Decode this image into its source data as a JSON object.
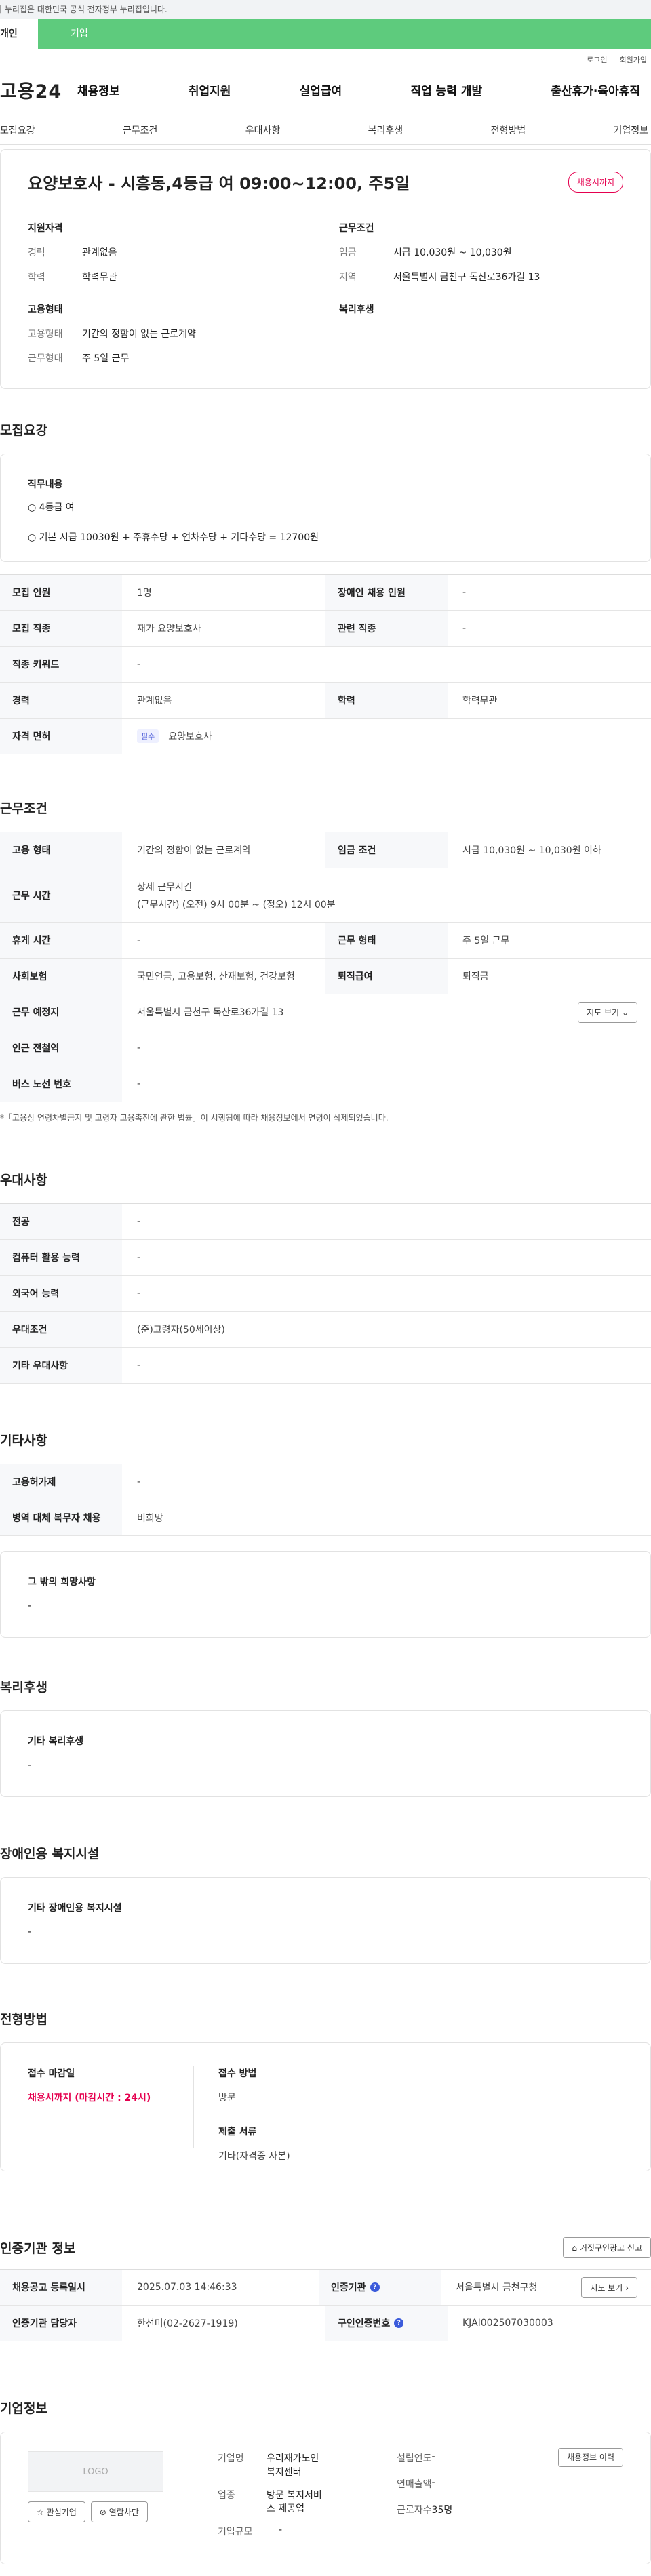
{
  "banner": "이 누리집은 대한민국 공식 전자정부 누리집입니다.",
  "tabs": [
    "개인",
    "기업"
  ],
  "util": [
    "로그인",
    "회원가입"
  ],
  "logo": "고용24",
  "gnb": [
    "채용정보",
    "취업지원",
    "실업급여",
    "직업 능력 개발",
    "출산휴가·육아휴직"
  ],
  "lnb": [
    "모집요강",
    "근무조건",
    "우대사항",
    "복리후생",
    "전형방법",
    "기업정보"
  ],
  "title": "요양보호사 - 시흥동,4등급 여 09:00~12:00, 주5일",
  "badge": "채용시까지",
  "summary": {
    "left_title": "지원자격",
    "left": [
      [
        "경력",
        "관계없음"
      ],
      [
        "학력",
        "학력무관"
      ]
    ],
    "right_title": "근무조건",
    "right": [
      [
        "임금",
        "시급 10,030원 ~ 10,030원"
      ],
      [
        "지역",
        "서울특별시 금천구 독산로36가길 13"
      ]
    ],
    "emp_title": "고용형태",
    "emp": [
      [
        "고용형태",
        "기간의 정함이 없는 근로계약"
      ],
      [
        "근무형태",
        "주 5일 근무"
      ]
    ],
    "welfare_title": "복리후생"
  },
  "recruit": {
    "title": "모집요강",
    "job_label": "직무내용",
    "job_lines": [
      "○ 4등급 여",
      "○ 기본 시급 10030원 + 주휴수당 + 연차수당 + 기타수당 = 12700원"
    ],
    "rows": [
      [
        "모집 인원",
        "1명",
        "장애인 채용 인원",
        "-"
      ],
      [
        "모집 직종",
        "재가 요양보호사",
        "관련 직종",
        "-"
      ],
      [
        "직종 키워드",
        "-"
      ],
      [
        "경력",
        "관계없음",
        "학력",
        "학력무관"
      ],
      [
        "자격 면허",
        "필수",
        "요양보호사"
      ]
    ]
  },
  "work": {
    "title": "근무조건",
    "rows": [
      [
        "고용 형태",
        "기간의 정함이 없는 근로계약",
        "임금 조건",
        "시급 10,030원 ~ 10,030원 이하"
      ],
      [
        "근무 시간",
        "상세 근무시간",
        "(근무시간) (오전) 9시 00분 ~ (정오) 12시 00분"
      ],
      [
        "휴게 시간",
        "-",
        "근무 형태",
        "주 5일 근무"
      ],
      [
        "사회보험",
        "국민연금, 고용보험, 산재보험, 건강보험",
        "퇴직급여",
        "퇴직금"
      ],
      [
        "근무 예정지",
        "서울특별시 금천구 독산로36가길 13",
        "지도 보기"
      ],
      [
        "인근 전철역",
        "-"
      ],
      [
        "버스 노선 번호",
        "-"
      ]
    ],
    "note": "*「고용상 연령차별금지 및 고령자 고용촉진에 관한 법률」이 시행됨에 따라 채용정보에서 연령이 삭제되었습니다."
  },
  "pref": {
    "title": "우대사항",
    "rows": [
      [
        "전공",
        "-"
      ],
      [
        "컴퓨터 활용 능력",
        "-"
      ],
      [
        "외국어 능력",
        "-"
      ],
      [
        "우대조건",
        "(준)고령자(50세이상)"
      ],
      [
        "기타 우대사항",
        "-"
      ]
    ]
  },
  "etc": {
    "title": "기타사항",
    "rows": [
      [
        "고용허가제",
        "-"
      ],
      [
        "병역 대체 복무자 채용",
        "비희망"
      ]
    ],
    "box_label": "그 밖의 희망사항",
    "box_value": "-"
  },
  "welfare": {
    "title": "복리후생",
    "label": "기타 복리후생",
    "value": "-"
  },
  "disab": {
    "title": "장애인용 복지시설",
    "label": "기타 장애인용 복지시설",
    "value": "-"
  },
  "sel": {
    "title": "전형방법",
    "deadline_label": "접수 마감일",
    "deadline": "채용시까지 (마감시간 : 24시)",
    "method_label": "접수 방법",
    "method": "방문",
    "docs_label": "제출 서류",
    "docs": "기타(자격증 사본)"
  },
  "cert": {
    "title": "인증기관 정보",
    "report": "거짓구인광고 신고",
    "r1": [
      "채용공고 등록일시",
      "2025.07.03 14:46:33",
      "인증기관",
      "서울특별시 금천구청",
      "지도 보기"
    ],
    "r2": [
      "인증기관 담당자",
      "한선미(02-2627-1919)",
      "구인인증번호",
      "KJAI002507030003"
    ]
  },
  "company": {
    "title": "기업정보",
    "logo": "LOGO",
    "fav": "관심기업",
    "block": "열람차단",
    "history": "채용정보 이력",
    "f": [
      [
        "기업명",
        "우리재가노인복지센터"
      ],
      [
        "업종",
        "방문 복지서비스 제공업"
      ],
      [
        "기업규모",
        "-"
      ]
    ],
    "g": [
      [
        "설립연도",
        "-"
      ],
      [
        "연매출액",
        "-"
      ],
      [
        "근로자수",
        "35명"
      ]
    ]
  }
}
